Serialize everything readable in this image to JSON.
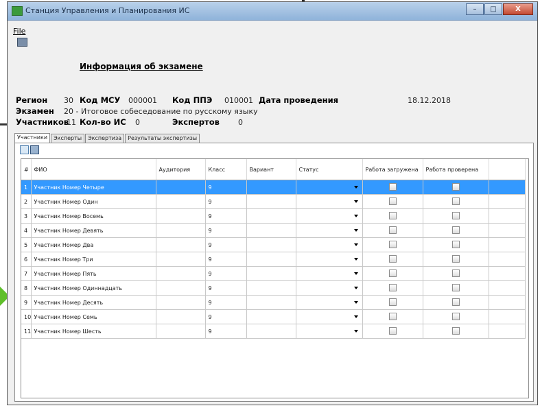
{
  "window": {
    "title": "Станция Управления и Планирования ИС",
    "buttons": {
      "minimize": "–",
      "maximize": "□",
      "close": "X"
    }
  },
  "menu": {
    "file": "File"
  },
  "info": {
    "heading": "Информация об экзамене",
    "region_label": "Регион",
    "region_value": "30",
    "msu_label": "Код МСУ",
    "msu_value": "000001",
    "ppe_label": "Код ППЭ",
    "ppe_value": "010001",
    "date_label": "Дата проведения",
    "date_value": "18.12.2018",
    "exam_label": "Экзамен",
    "exam_value": "20 - Итоговое собеседование по русскому языку",
    "participants_label": "Участников",
    "participants_value": "11",
    "is_count_label": "Кол-во ИС",
    "is_count_value": "0",
    "experts_label": "Экспертов",
    "experts_value": "0"
  },
  "tabs": [
    "Участники",
    "Эксперты",
    "Экспертиза",
    "Результаты экспертизы"
  ],
  "table": {
    "headers": [
      "#",
      "ФИО",
      "Аудитория",
      "Класс",
      "Вариант",
      "Статус",
      "Работа загружена",
      "Работа проверена"
    ],
    "rows": [
      {
        "num": "1",
        "fio": "Участник Номер Четыре",
        "class": "9"
      },
      {
        "num": "2",
        "fio": "Участник Номер Один",
        "class": "9"
      },
      {
        "num": "3",
        "fio": "Участник Номер Восемь",
        "class": "9"
      },
      {
        "num": "4",
        "fio": "Участник Номер Девять",
        "class": "9"
      },
      {
        "num": "5",
        "fio": "Участник Номер Два",
        "class": "9"
      },
      {
        "num": "6",
        "fio": "Участник Номер Три",
        "class": "9"
      },
      {
        "num": "7",
        "fio": "Участник Номер Пять",
        "class": "9"
      },
      {
        "num": "8",
        "fio": "Участник Номер Одиннадцать",
        "class": "9"
      },
      {
        "num": "9",
        "fio": "Участник Номер Десять",
        "class": "9"
      },
      {
        "num": "10",
        "fio": "Участник Номер Семь",
        "class": "9"
      },
      {
        "num": "11",
        "fio": "Участник Номер Шесть",
        "class": "9"
      }
    ],
    "selected_row": 0
  },
  "colors": {
    "selection": "#3399ff",
    "arrow": "#5fbf2a"
  }
}
